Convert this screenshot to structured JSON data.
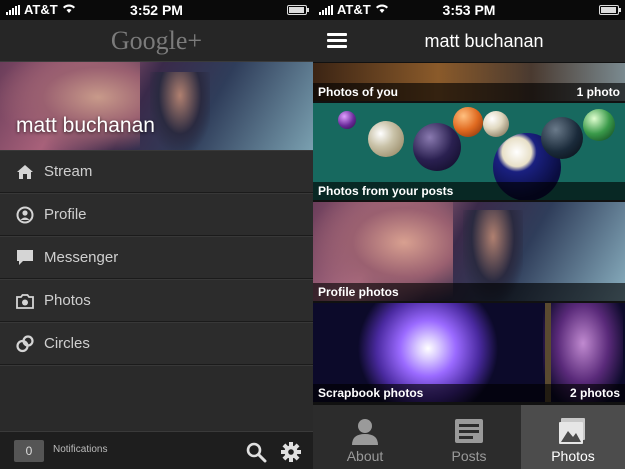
{
  "left_screen": {
    "status": {
      "carrier": "AT&T",
      "time": "3:52 PM"
    },
    "logo": "Google+",
    "profile_name": "matt buchanan",
    "menu": [
      {
        "label": "Stream",
        "icon": "home-icon"
      },
      {
        "label": "Profile",
        "icon": "profile-icon"
      },
      {
        "label": "Messenger",
        "icon": "messenger-icon"
      },
      {
        "label": "Photos",
        "icon": "camera-icon"
      },
      {
        "label": "Circles",
        "icon": "circles-icon"
      }
    ],
    "footer": {
      "notification_count": "0",
      "notifications_label": "Notifications",
      "icons": [
        "search-icon",
        "gear-icon"
      ]
    }
  },
  "right_screen": {
    "status": {
      "carrier": "AT&T",
      "time": "3:53 PM"
    },
    "title": "matt buchanan",
    "albums": [
      {
        "title": "Photos of you",
        "count": "1 photo"
      },
      {
        "title": "Photos from your posts",
        "count": ""
      },
      {
        "title": "Profile photos",
        "count": ""
      },
      {
        "title": "Scrapbook photos",
        "count": "2 photos"
      }
    ],
    "tabs": [
      {
        "label": "About",
        "icon": "person-icon"
      },
      {
        "label": "Posts",
        "icon": "posts-icon"
      },
      {
        "label": "Photos",
        "icon": "photos-icon",
        "active": true
      }
    ]
  },
  "colors": {
    "table_green": "#17695f",
    "header_bg": "#262626",
    "active_tab": "#4c4c4c"
  }
}
